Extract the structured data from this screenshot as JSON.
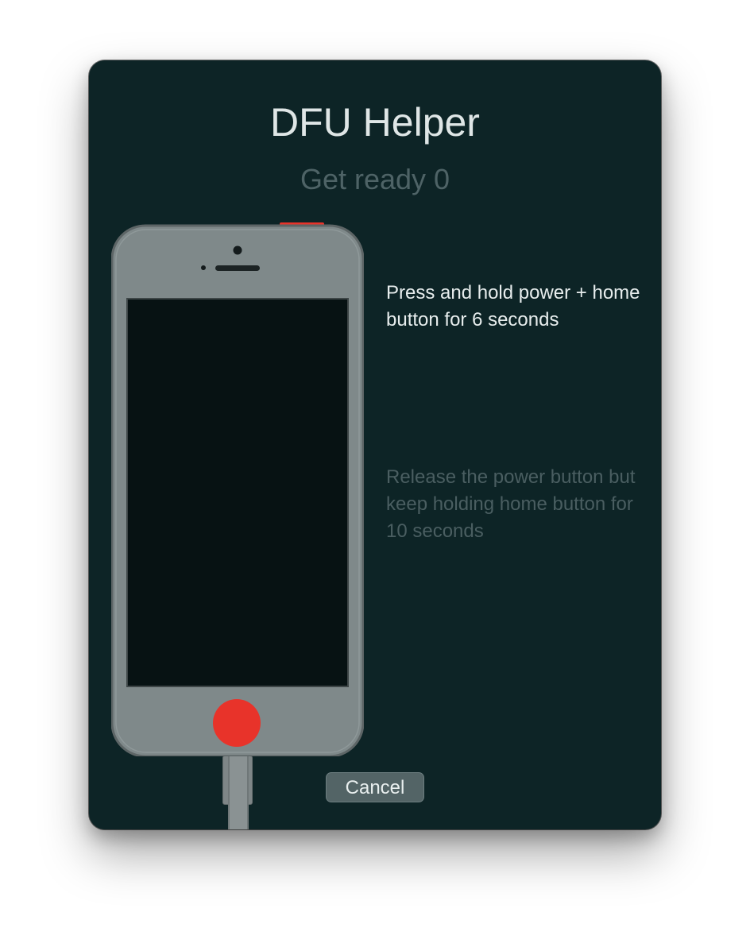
{
  "dialog": {
    "title": "DFU Helper",
    "subtitle": "Get ready 0",
    "steps": [
      {
        "text": "Press and hold power + home button for 6 seconds",
        "state": "active"
      },
      {
        "text": "Release the power button but keep holding home button for 10 seconds",
        "state": "inactive"
      }
    ],
    "cancel_label": "Cancel"
  },
  "device": {
    "highlighted_buttons": [
      "power",
      "home"
    ]
  },
  "colors": {
    "window_background": "#0d2426",
    "highlight": "#e8332a",
    "phone_body": "#7f898a",
    "phone_screen": "#071213"
  }
}
